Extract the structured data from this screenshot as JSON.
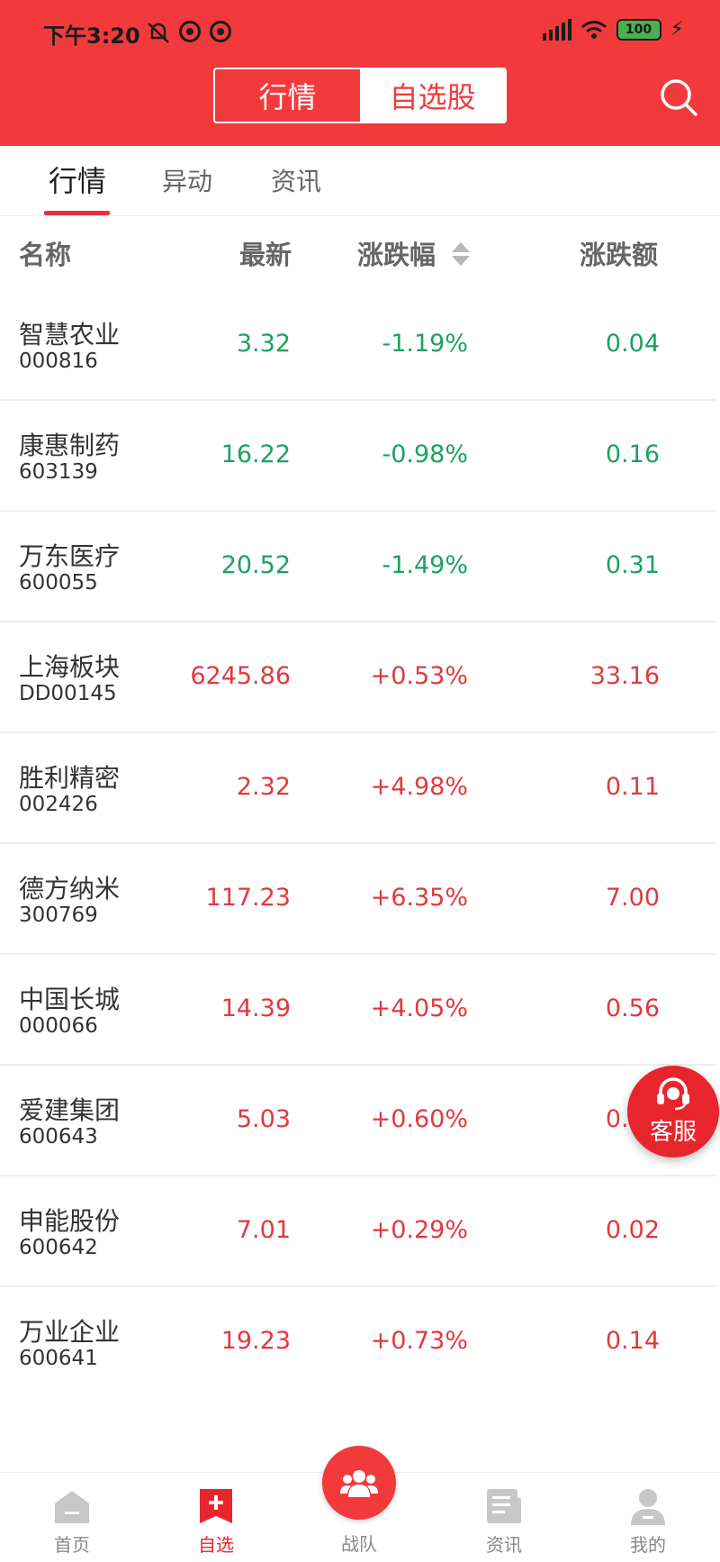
{
  "status_bar": {
    "time": "下午3:20",
    "battery": "100"
  },
  "header": {
    "segments": [
      {
        "label": "行情",
        "active": false
      },
      {
        "label": "自选股",
        "active": true
      }
    ]
  },
  "subtabs": [
    {
      "label": "行情",
      "active": true
    },
    {
      "label": "异动",
      "active": false
    },
    {
      "label": "资讯",
      "active": false
    }
  ],
  "columns": {
    "name": "名称",
    "price": "最新",
    "pct": "涨跌幅",
    "change": "涨跌额"
  },
  "colors": {
    "up": "#e03a3e",
    "down": "#1aa260",
    "brand": "#f23a3c"
  },
  "stocks": [
    {
      "name": "智慧农业",
      "code": "000816",
      "price": "3.32",
      "pct": "-1.19%",
      "change": "0.04",
      "trend": "down"
    },
    {
      "name": "康惠制药",
      "code": "603139",
      "price": "16.22",
      "pct": "-0.98%",
      "change": "0.16",
      "trend": "down"
    },
    {
      "name": "万东医疗",
      "code": "600055",
      "price": "20.52",
      "pct": "-1.49%",
      "change": "0.31",
      "trend": "down"
    },
    {
      "name": "上海板块",
      "code": "DD00145",
      "price": "6245.86",
      "pct": "+0.53%",
      "change": "33.16",
      "trend": "up"
    },
    {
      "name": "胜利精密",
      "code": "002426",
      "price": "2.32",
      "pct": "+4.98%",
      "change": "0.11",
      "trend": "up"
    },
    {
      "name": "德方纳米",
      "code": "300769",
      "price": "117.23",
      "pct": "+6.35%",
      "change": "7.00",
      "trend": "up"
    },
    {
      "name": "中国长城",
      "code": "000066",
      "price": "14.39",
      "pct": "+4.05%",
      "change": "0.56",
      "trend": "up"
    },
    {
      "name": "爱建集团",
      "code": "600643",
      "price": "5.03",
      "pct": "+0.60%",
      "change": "0.03",
      "trend": "up"
    },
    {
      "name": "申能股份",
      "code": "600642",
      "price": "7.01",
      "pct": "+0.29%",
      "change": "0.02",
      "trend": "up"
    },
    {
      "name": "万业企业",
      "code": "600641",
      "price": "19.23",
      "pct": "+0.73%",
      "change": "0.14",
      "trend": "up"
    }
  ],
  "service_button": {
    "label": "客服",
    "icon": "headset-icon"
  },
  "bottom_nav": [
    {
      "label": "首页",
      "icon": "home-icon",
      "active": false
    },
    {
      "label": "自选",
      "icon": "watchlist-icon",
      "active": true
    },
    {
      "label": "战队",
      "icon": "team-icon",
      "active": false
    },
    {
      "label": "资讯",
      "icon": "news-icon",
      "active": false
    },
    {
      "label": "我的",
      "icon": "profile-icon",
      "active": false
    }
  ]
}
